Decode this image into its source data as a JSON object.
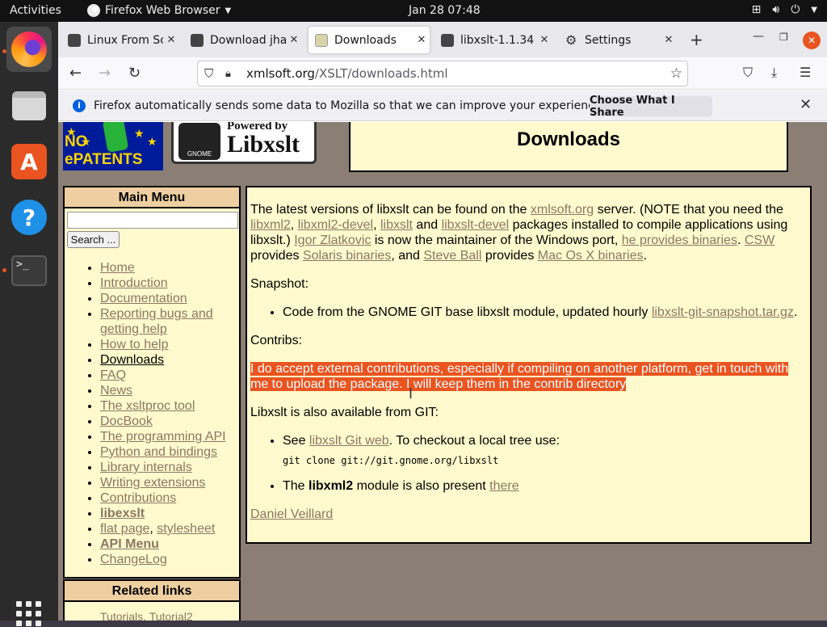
{
  "topbar": {
    "activities": "Activities",
    "app_name": "Firefox Web Browser",
    "clock": "Jan 28  07:48"
  },
  "tabs": [
    {
      "title": "Linux From Sc",
      "favicon": "linux-from-scratch",
      "active": false
    },
    {
      "title": "Download jhal",
      "favicon": "linux-from-scratch",
      "active": false
    },
    {
      "title": "Downloads",
      "favicon": "xmlsoft",
      "active": true
    },
    {
      "title": "libxslt-1.1.34",
      "favicon": "linux-from-scratch",
      "active": false
    },
    {
      "title": "Settings",
      "favicon": "gear-icon",
      "active": false
    }
  ],
  "url": {
    "host": "xmlsoft.org",
    "path": "/XSLT/downloads.html"
  },
  "notification": {
    "message": "Firefox automatically sends some data to Mozilla so that we can improve your experience.",
    "button": "Choose What I Share"
  },
  "page": {
    "logo_left": "NO ePATENTS",
    "logo_right_top": "Powered by",
    "logo_right_main": "Libxslt",
    "logo_right_small": "GNOME",
    "title": "Downloads",
    "main_menu": {
      "heading": "Main Menu",
      "search_button": "Search ...",
      "items": [
        {
          "label": "Home"
        },
        {
          "label": "Introduction"
        },
        {
          "label": "Documentation"
        },
        {
          "label": "Reporting bugs and getting help"
        },
        {
          "label": "How to help"
        },
        {
          "label": "Downloads",
          "current": true
        },
        {
          "label": "FAQ"
        },
        {
          "label": "News"
        },
        {
          "label": "The xsltproc tool"
        },
        {
          "label": "DocBook"
        },
        {
          "label": "The programming API"
        },
        {
          "label": "Python and bindings"
        },
        {
          "label": "Library internals"
        },
        {
          "label": "Writing extensions"
        },
        {
          "label": "Contributions"
        },
        {
          "label": "libexslt",
          "bold": true
        },
        {
          "label": "flat page",
          "extra": "stylesheet"
        },
        {
          "label": "API Menu",
          "bold": true
        },
        {
          "label": "ChangeLog"
        }
      ]
    },
    "related": {
      "heading": "Related links",
      "peek": "Tutorials, Tutorial2"
    },
    "content": {
      "p1_a": "The latest versions of libxslt can be found on the ",
      "p1_link1": "xmlsoft.org",
      "p1_b": " server. (NOTE that you need the ",
      "p1_link2": "libxml2",
      "p1_c": ", ",
      "p1_link3": "libxml2-devel",
      "p1_d": ", ",
      "p1_link4": "libxslt",
      "p1_e": " and ",
      "p1_link5": "libxslt-devel",
      "p1_f": " packages installed to compile applications using libxslt.) ",
      "p1_link6": "Igor Zlatkovic",
      "p1_g": " is now the maintainer of the Windows port, ",
      "p1_link7": "he provides binaries",
      "p1_h": ". ",
      "p1_link8": "CSW",
      "p1_i": " provides ",
      "p1_link9": "Solaris binaries",
      "p1_j": ", and ",
      "p1_link10": "Steve Ball",
      "p1_k": " provides ",
      "p1_link11": "Mac Os X binaries",
      "p1_l": ".",
      "snapshot_label": "Snapshot:",
      "snapshot_text": "Code from the GNOME GIT base libxslt module, updated hourly ",
      "snapshot_link": "libxslt-git-snapshot.tar.gz",
      "snapshot_end": ".",
      "contribs_label": "Contribs:",
      "contribs_text": "I do accept external contributions, especially if compiling on another platform, get in touch with me to upload the package. I will keep them in the contrib directory",
      "git_label": "Libxslt is also available from GIT:",
      "git_see": "See ",
      "git_link": "libxslt Git web",
      "git_rest": ". To checkout a local tree use:",
      "git_cmd": "git clone git://git.gnome.org/libxslt",
      "libxml_a": "The ",
      "libxml_b": "libxml2",
      "libxml_c": " module is also present ",
      "libxml_link": "there",
      "author": "Daniel Veillard"
    }
  },
  "colors": {
    "accent": "#e95420",
    "page_bg": "#8b7f75",
    "box_bg": "#fffacd",
    "menu_head": "#eecfa1",
    "link": "#8b7765"
  }
}
